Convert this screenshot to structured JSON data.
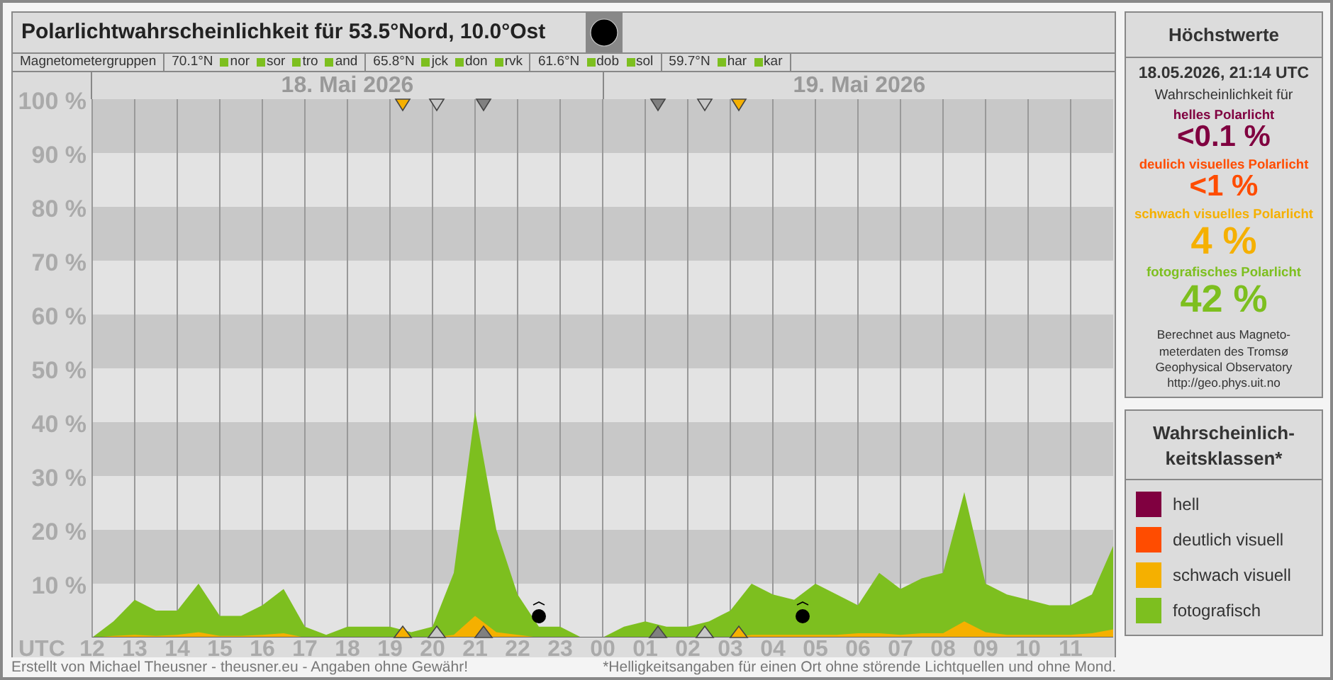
{
  "title": "Polarlichtwahrscheinlichkeit für 53.5°Nord, 10.0°Ost",
  "magnetometer": {
    "label": "Magnetometergruppen",
    "groups": [
      {
        "latitude": "70.1°N",
        "stations": [
          {
            "name": "nor",
            "color": "#7dbf1f"
          },
          {
            "name": "sor",
            "color": "#7dbf1f"
          },
          {
            "name": "tro",
            "color": "#7dbf1f"
          },
          {
            "name": "and",
            "color": "#7dbf1f"
          }
        ]
      },
      {
        "latitude": "65.8°N",
        "stations": [
          {
            "name": "jck",
            "color": "#7dbf1f"
          },
          {
            "name": "don",
            "color": "#7dbf1f"
          },
          {
            "name": "rvk",
            "color": "#7dbf1f"
          }
        ]
      },
      {
        "latitude": "61.6°N",
        "stations": [
          {
            "name": "dob",
            "color": "#7dbf1f"
          },
          {
            "name": "sol",
            "color": "#7dbf1f"
          }
        ]
      },
      {
        "latitude": "59.7°N",
        "stations": [
          {
            "name": "har",
            "color": "#7dbf1f"
          },
          {
            "name": "kar",
            "color": "#7dbf1f"
          }
        ]
      }
    ]
  },
  "dates": [
    "18. Mai 2026",
    "19. Mai 2026"
  ],
  "x_axis_label": "UTC",
  "markers": [
    {
      "kind": "triangle",
      "color": "#f5b000"
    },
    {
      "kind": "triangle",
      "color": "#c8c8c8"
    },
    {
      "kind": "triangle",
      "color": "#808080"
    },
    {
      "kind": "triangle",
      "color": "#808080"
    },
    {
      "kind": "triangle",
      "color": "#c8c8c8"
    },
    {
      "kind": "triangle",
      "color": "#f5b000"
    },
    {
      "kind": "triangle",
      "color": "#f5b000"
    },
    {
      "kind": "triangle",
      "color": "#c8c8c8"
    },
    {
      "kind": "triangle",
      "color": "#808080"
    },
    {
      "kind": "triangle",
      "color": "#808080"
    },
    {
      "kind": "triangle",
      "color": "#c8c8c8"
    },
    {
      "kind": "triangle",
      "color": "#f5b000"
    },
    {
      "kind": "moon",
      "color": "#000000"
    },
    {
      "kind": "moon",
      "color": "#000000"
    }
  ],
  "chart_data": {
    "type": "area",
    "stacked": false,
    "grid": true,
    "ylim": [
      0,
      100
    ],
    "yticks": [
      {
        "value": 10,
        "label": "10 %"
      },
      {
        "value": 20,
        "label": "20 %"
      },
      {
        "value": 30,
        "label": "30 %"
      },
      {
        "value": 40,
        "label": "40 %"
      },
      {
        "value": 50,
        "label": "50 %"
      },
      {
        "value": 60,
        "label": "60 %"
      },
      {
        "value": 70,
        "label": "70 %"
      },
      {
        "value": 80,
        "label": "80 %"
      },
      {
        "value": 90,
        "label": "90 %"
      },
      {
        "value": 100,
        "label": "100 %"
      }
    ],
    "categories": [
      "12",
      null,
      "13",
      null,
      "14",
      null,
      "15",
      null,
      "16",
      null,
      "17",
      null,
      "18",
      null,
      "19",
      null,
      "20",
      null,
      "21",
      null,
      "22",
      null,
      "23",
      null,
      "00",
      null,
      "01",
      null,
      "02",
      null,
      "03",
      null,
      "04",
      null,
      "05",
      null,
      "06",
      null,
      "07",
      null,
      "08",
      null,
      "09",
      null,
      "10",
      null,
      "11",
      null,
      null
    ],
    "series": [
      {
        "color": "#7dbf1f",
        "values": [
          0,
          3,
          7,
          5,
          5,
          10,
          4,
          4,
          6,
          9,
          2,
          0.5,
          2,
          2,
          2,
          1,
          2,
          12,
          42,
          20,
          8,
          2,
          2,
          0,
          0,
          2,
          3,
          2,
          2,
          3,
          5,
          10,
          8,
          7,
          10,
          8,
          6,
          12,
          9,
          11,
          12,
          27,
          10,
          8,
          7,
          6,
          6,
          8,
          17
        ]
      },
      {
        "color": "#f5b000",
        "values": [
          0,
          0.3,
          0.5,
          0.3,
          0.5,
          1,
          0.3,
          0.3,
          0.5,
          0.8,
          0,
          0,
          0,
          0,
          0,
          0,
          0,
          0.5,
          4,
          1,
          0.5,
          0,
          0,
          0,
          0,
          0,
          0,
          0,
          0,
          0,
          0,
          0.5,
          0.5,
          0.5,
          0.5,
          0.5,
          0.8,
          0.8,
          0.5,
          0.8,
          0.8,
          3,
          1,
          0.5,
          0.5,
          0.5,
          0.5,
          0.8,
          1.5
        ]
      }
    ]
  },
  "maxima": {
    "title": "Höchstwerte",
    "timestamp": "18.05.2026, 21:14 UTC",
    "intro": "Wahrscheinlichkeit für",
    "classes": [
      {
        "label": "helles Polarlicht",
        "value": "<0.1 %",
        "color": "#800040"
      },
      {
        "label": "deulich visuelles Polarlicht",
        "value": "<1 %",
        "color": "#ff4c00"
      },
      {
        "label": "schwach visuelles Polarlicht",
        "value": "4 %",
        "color": "#f5b000"
      },
      {
        "label": "fotografisches Polarlicht",
        "value": "42 %",
        "color": "#7dbf1f"
      }
    ],
    "note_lines": [
      "Berechnet aus Magneto-",
      "meterdaten des Tromsø",
      "Geophysical Observatory",
      "http://geo.phys.uit.no"
    ]
  },
  "legend": {
    "title_lines": [
      "Wahrscheinlich-",
      "keitsklassen*"
    ],
    "items": [
      {
        "label": "hell",
        "color": "#800040"
      },
      {
        "label": "deutlich visuell",
        "color": "#ff4c00"
      },
      {
        "label": "schwach visuell",
        "color": "#f5b000"
      },
      {
        "label": "fotografisch",
        "color": "#7dbf1f"
      }
    ]
  },
  "footer": {
    "credit": "Erstellt von Michael Theusner - theusner.eu - Angaben ohne Gewähr!",
    "note": "*Helligkeitsangaben für einen Ort ohne störende Lichtquellen und ohne Mond."
  }
}
